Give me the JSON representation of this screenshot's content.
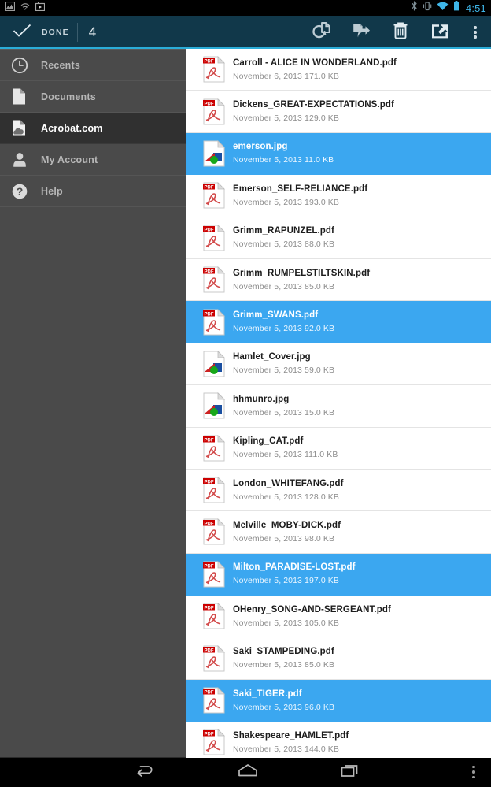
{
  "statusbar": {
    "time": "4:51",
    "left_icons": [
      "screenshot-icon",
      "help-wifi-icon",
      "app-store-icon"
    ],
    "right_icons": [
      "bluetooth-icon",
      "vibrate-icon",
      "wifi-icon",
      "battery-icon"
    ],
    "accent_color": "#3fb6e8"
  },
  "actionbar": {
    "done_label": "DONE",
    "selection_count": "4",
    "background": "#11384a",
    "underline_color": "#2badd8",
    "actions": [
      {
        "name": "copy-to-button",
        "icon": "copy-to-icon"
      },
      {
        "name": "move-button",
        "icon": "move-file-icon"
      },
      {
        "name": "delete-button",
        "icon": "trash-icon"
      },
      {
        "name": "export-button",
        "icon": "export-icon"
      },
      {
        "name": "overflow-menu-button",
        "icon": "kebab-icon"
      }
    ]
  },
  "sidebar": {
    "background": "#4a4a4a",
    "active_background": "#303030",
    "items": [
      {
        "label": "Recents",
        "icon": "clock-icon",
        "active": false
      },
      {
        "label": "Documents",
        "icon": "document-icon",
        "active": false
      },
      {
        "label": "Acrobat.com",
        "icon": "cloud-document-icon",
        "active": true
      },
      {
        "label": "My Account",
        "icon": "person-icon",
        "active": false
      },
      {
        "label": "Help",
        "icon": "question-mark-icon",
        "active": false
      }
    ]
  },
  "filelist": {
    "selected_color": "#3ba7f0",
    "rows": [
      {
        "name": "Carroll - ALICE IN WONDERLAND.pdf",
        "date": "November 6, 2013",
        "size": "171.0 KB",
        "type": "pdf",
        "selected": false
      },
      {
        "name": "Dickens_GREAT-EXPECTATIONS.pdf",
        "date": "November 5, 2013",
        "size": "129.0 KB",
        "type": "pdf",
        "selected": false
      },
      {
        "name": "emerson.jpg",
        "date": "November 5, 2013",
        "size": "11.0 KB",
        "type": "image",
        "selected": true
      },
      {
        "name": "Emerson_SELF-RELIANCE.pdf",
        "date": "November 5, 2013",
        "size": "193.0 KB",
        "type": "pdf",
        "selected": false
      },
      {
        "name": "Grimm_RAPUNZEL.pdf",
        "date": "November 5, 2013",
        "size": "88.0 KB",
        "type": "pdf",
        "selected": false
      },
      {
        "name": "Grimm_RUMPELSTILTSKIN.pdf",
        "date": "November 5, 2013",
        "size": "85.0 KB",
        "type": "pdf",
        "selected": false
      },
      {
        "name": "Grimm_SWANS.pdf",
        "date": "November 5, 2013",
        "size": "92.0 KB",
        "type": "pdf",
        "selected": true
      },
      {
        "name": "Hamlet_Cover.jpg",
        "date": "November 5, 2013",
        "size": "59.0 KB",
        "type": "image",
        "selected": false
      },
      {
        "name": "hhmunro.jpg",
        "date": "November 5, 2013",
        "size": "15.0 KB",
        "type": "image",
        "selected": false
      },
      {
        "name": "Kipling_CAT.pdf",
        "date": "November 5, 2013",
        "size": "111.0 KB",
        "type": "pdf",
        "selected": false
      },
      {
        "name": "London_WHITEFANG.pdf",
        "date": "November 5, 2013",
        "size": "128.0 KB",
        "type": "pdf",
        "selected": false
      },
      {
        "name": "Melville_MOBY-DICK.pdf",
        "date": "November 5, 2013",
        "size": "98.0 KB",
        "type": "pdf",
        "selected": false
      },
      {
        "name": "Milton_PARADISE-LOST.pdf",
        "date": "November 5, 2013",
        "size": "197.0 KB",
        "type": "pdf",
        "selected": true
      },
      {
        "name": "OHenry_SONG-AND-SERGEANT.pdf",
        "date": "November 5, 2013",
        "size": "105.0 KB",
        "type": "pdf",
        "selected": false
      },
      {
        "name": "Saki_STAMPEDING.pdf",
        "date": "November 5, 2013",
        "size": "85.0 KB",
        "type": "pdf",
        "selected": false
      },
      {
        "name": "Saki_TIGER.pdf",
        "date": "November 5, 2013",
        "size": "96.0 KB",
        "type": "pdf",
        "selected": true
      },
      {
        "name": "Shakespeare_HAMLET.pdf",
        "date": "November 5, 2013",
        "size": "144.0 KB",
        "type": "pdf",
        "selected": false
      }
    ]
  },
  "navbar": {
    "buttons": [
      {
        "name": "back-button",
        "icon": "back-arrow-icon"
      },
      {
        "name": "home-button",
        "icon": "home-icon"
      },
      {
        "name": "recents-button",
        "icon": "recents-icon"
      },
      {
        "name": "nav-overflow-button",
        "icon": "kebab-icon"
      }
    ]
  }
}
